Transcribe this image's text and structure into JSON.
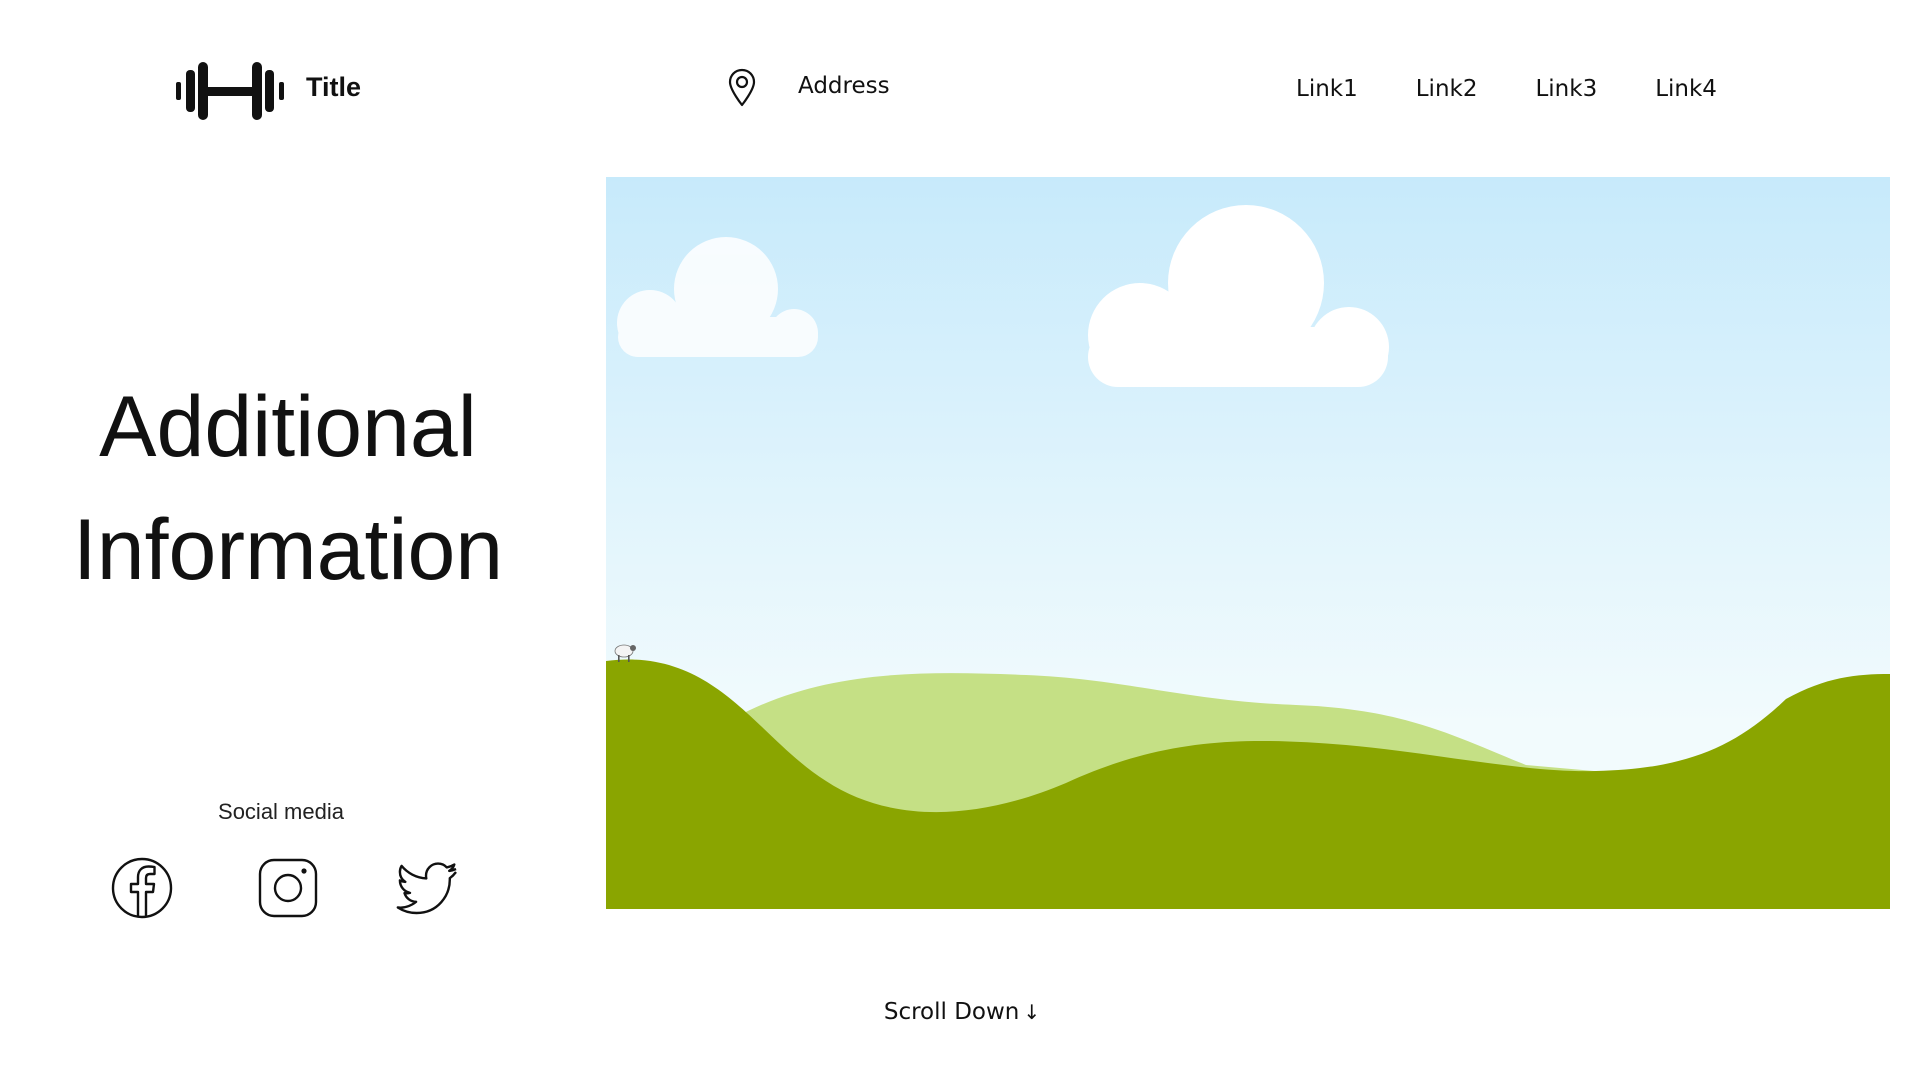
{
  "header": {
    "brand": {
      "logo_icon": "dumbbell-icon",
      "title": "Title"
    },
    "address": {
      "icon": "map-pin-icon",
      "text": "Address"
    },
    "nav": {
      "links": [
        "Link1",
        "Link2",
        "Link3",
        "Link4"
      ]
    }
  },
  "main": {
    "headline_line1": "Additional",
    "headline_line2": "Information",
    "social": {
      "label": "Social media",
      "icons": [
        "facebook-icon",
        "instagram-icon",
        "twitter-icon"
      ]
    },
    "hero": {
      "description_icon": "landscape-illustration",
      "sky_top_color": "#c7eafb",
      "sky_bottom_color": "#f2fbfd",
      "hill_dark_color": "#8aa500",
      "hill_light_color": "#c5e085",
      "cloud_color": "#ffffff"
    }
  },
  "footer": {
    "scroll_label": "Scroll Down",
    "scroll_arrow": "↓"
  }
}
